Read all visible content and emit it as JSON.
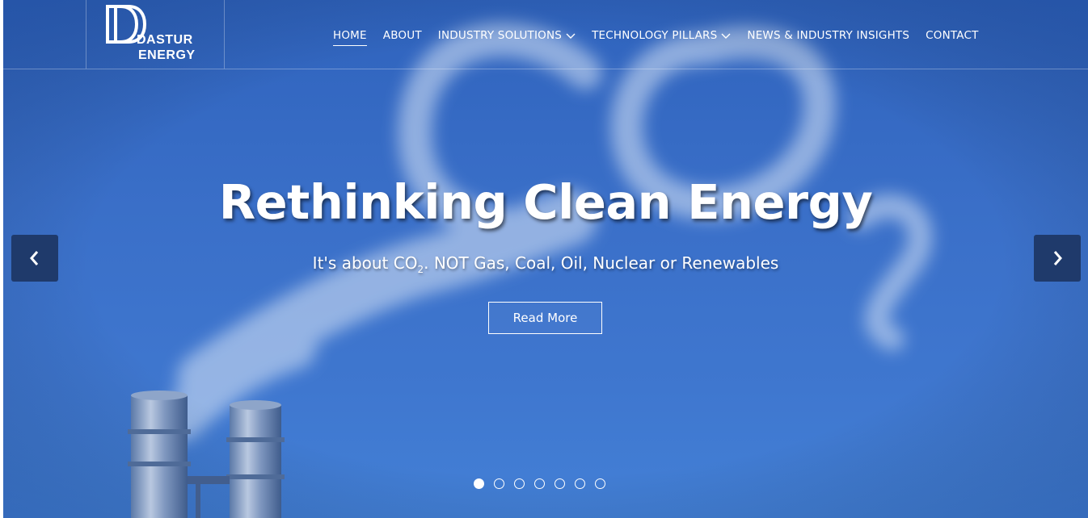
{
  "brand": {
    "line1": "DASTUR",
    "line2": "ENERGY"
  },
  "nav": {
    "home": "HOME",
    "about": "ABOUT",
    "industry": "INDUSTRY SOLUTIONS",
    "technology": "TECHNOLOGY PILLARS",
    "news": "NEWS & INDUSTRY INSIGHTS",
    "contact": "CONTACT"
  },
  "hero": {
    "headline": "Rethinking Clean Energy",
    "sub_before": "It's about CO",
    "sub_subscript": "2",
    "sub_after": ". NOT Gas, Coal, Oil, Nuclear or Renewables",
    "button": "Read More"
  },
  "slider": {
    "slide_count": 7,
    "active_slide": 1,
    "prev_icon": "chevron-left-icon",
    "next_icon": "chevron-right-icon"
  },
  "colors": {
    "sky": "#3a6fc8",
    "arrow_bg": "#1f3a6b",
    "text": "#ffffff"
  }
}
